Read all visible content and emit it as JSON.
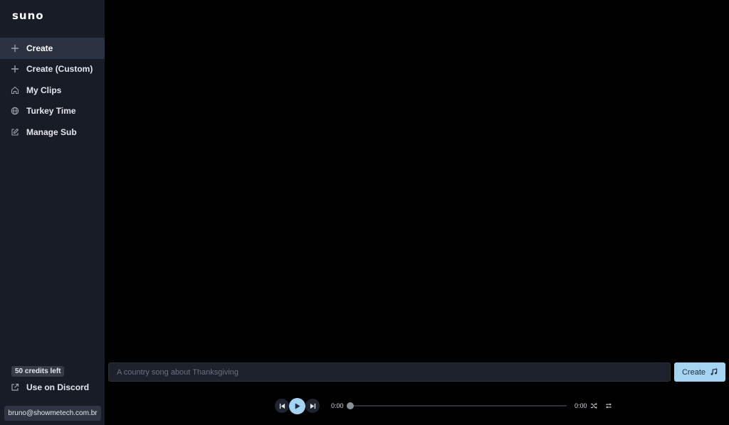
{
  "app": {
    "logo": "suno"
  },
  "sidebar": {
    "items": [
      {
        "label": "Create",
        "icon": "plus-icon",
        "active": true
      },
      {
        "label": "Create (Custom)",
        "icon": "plus-icon",
        "active": false
      },
      {
        "label": "My Clips",
        "icon": "home-icon",
        "active": false
      },
      {
        "label": "Turkey Time",
        "icon": "globe-icon",
        "active": false
      },
      {
        "label": "Manage Sub",
        "icon": "edit-icon",
        "active": false
      }
    ],
    "credits": "50 credits left",
    "discord_label": "Use on Discord",
    "email": "bruno@showmetech.com.br"
  },
  "prompt": {
    "placeholder": "A country song about Thanksgiving",
    "value": "",
    "create_label": "Create"
  },
  "player": {
    "current_time": "0:00",
    "duration": "0:00",
    "progress": 0
  },
  "colors": {
    "sidebar_bg": "#181c27",
    "active_item_bg": "#2b3241",
    "accent": "#a5d4f3",
    "main_bg": "#000000"
  }
}
